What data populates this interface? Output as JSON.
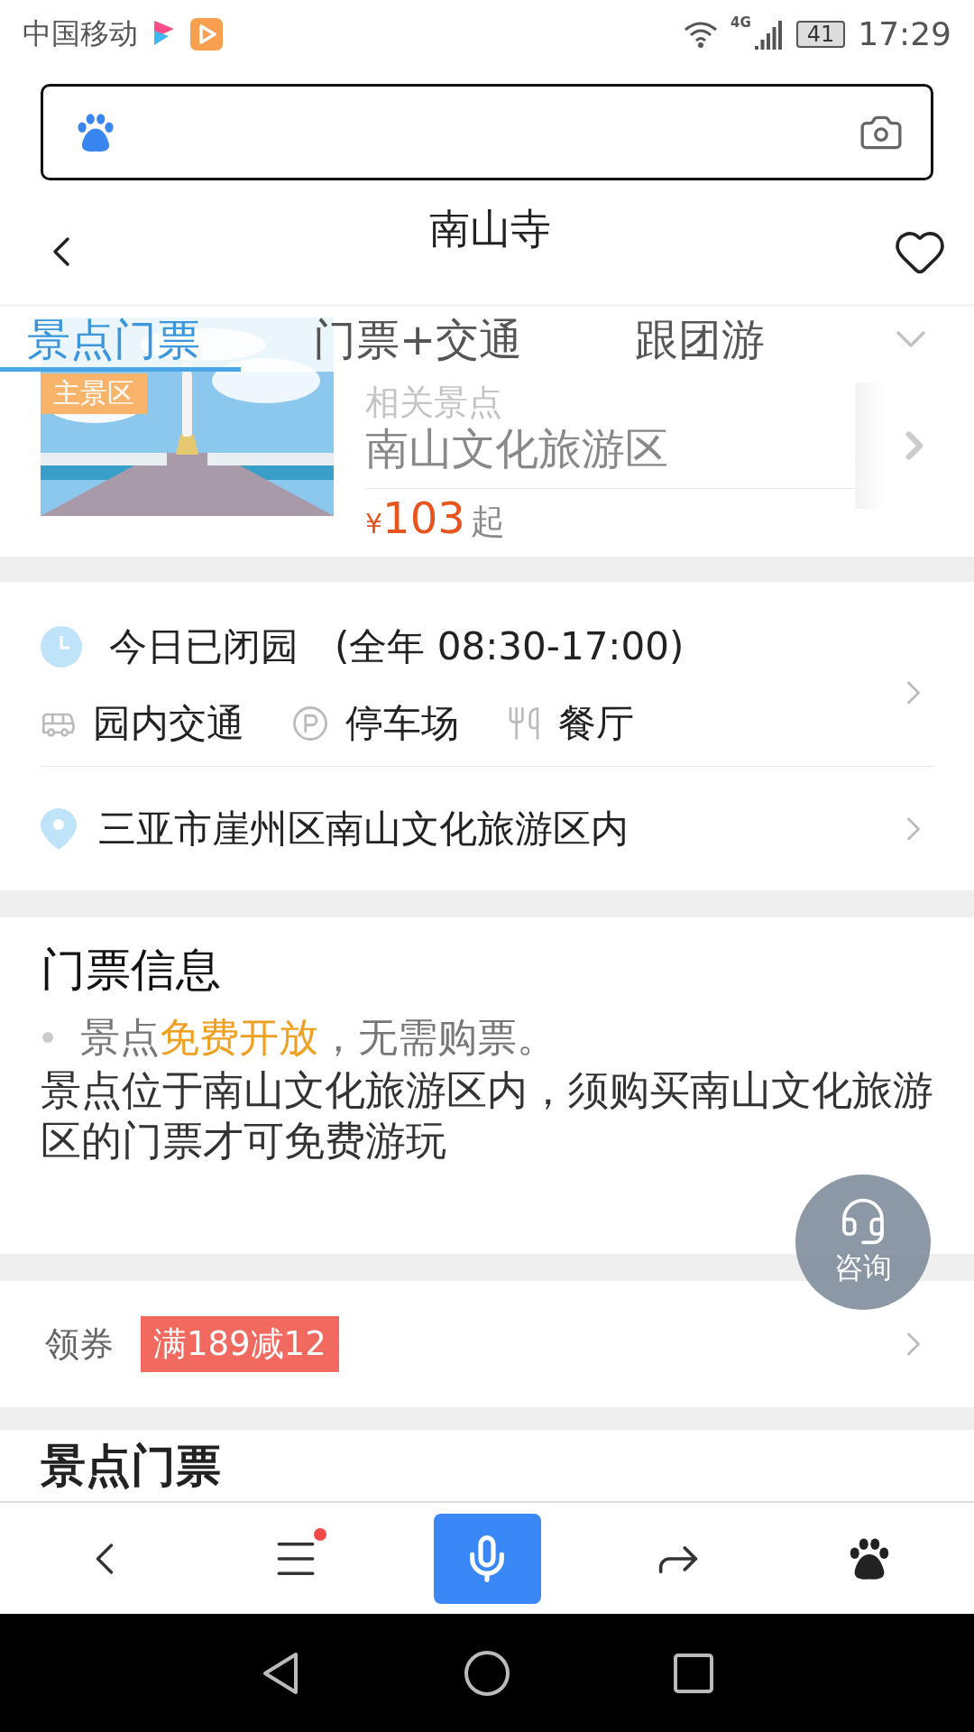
{
  "status_bar": {
    "carrier": "中国移动",
    "network": "4G",
    "battery": "41",
    "time": "17:29"
  },
  "header": {
    "title": "南山寺",
    "favorite": false
  },
  "tabs": [
    {
      "label": "景点门票",
      "selected": true
    },
    {
      "label": "门票+交通",
      "selected": false
    },
    {
      "label": "跟团游",
      "selected": false
    }
  ],
  "related": {
    "badge": "主景区",
    "label": "相关景点",
    "name": "南山文化旅游区",
    "currency": "¥",
    "price": "103",
    "suffix": "起"
  },
  "hours": {
    "status": "今日已闭园",
    "schedule": "(全年 08:30-17:00)"
  },
  "facilities": [
    {
      "kind": "bus",
      "label": "园内交通"
    },
    {
      "kind": "parking",
      "label": "停车场"
    },
    {
      "kind": "dining",
      "label": "餐厅"
    }
  ],
  "address": "三亚市崖州区南山文化旅游区内",
  "ticket_info": {
    "title": "门票信息",
    "bullet": [
      {
        "text": "景点",
        "highlight": false
      },
      {
        "text": "免费开放",
        "highlight": true
      },
      {
        "text": "，无需购票。",
        "highlight": false
      }
    ],
    "note": "景点位于南山文化旅游区内，须购买南山文化旅游区的门票才可免费游玩"
  },
  "consult": {
    "label": "咨询"
  },
  "coupon": {
    "label": "领券",
    "tag": "满189减12"
  },
  "next_section": {
    "title": "景点门票"
  },
  "toolbar": {
    "menu_notification": true
  }
}
